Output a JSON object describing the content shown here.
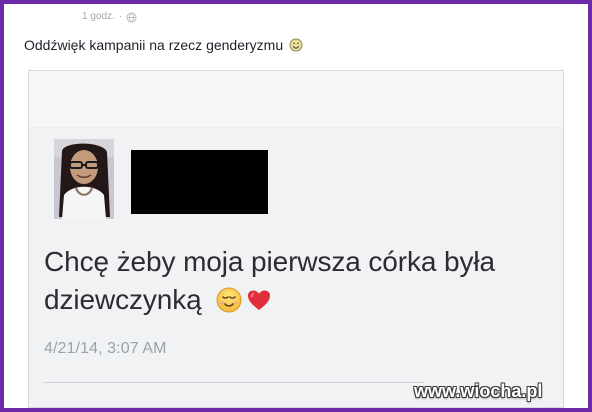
{
  "post": {
    "time": "1 godz.",
    "separator": "·",
    "text": "Oddźwięk kampanii na rzecz genderyzmu"
  },
  "tweet": {
    "line1": "Chcę żeby moja pierwsza córka była",
    "line2": "dziewczynką",
    "timestamp": "4/21/14, 3:07 AM"
  },
  "watermark": {
    "text": "www.wiocha.pl"
  },
  "icons": {
    "privacy": "globe-icon",
    "post_emoji": "smile-emoji",
    "tweet_emoji": "relieved-emoji",
    "tweet_heart": "heart-icon"
  },
  "colors": {
    "frame_border": "#6d2aa8",
    "text": "#1d2129",
    "meta": "#a2a8b1",
    "tweet_text": "#2b2d31",
    "timestamp": "#9aa1ab",
    "redaction": "#000000",
    "heart": "#e02f3b"
  }
}
